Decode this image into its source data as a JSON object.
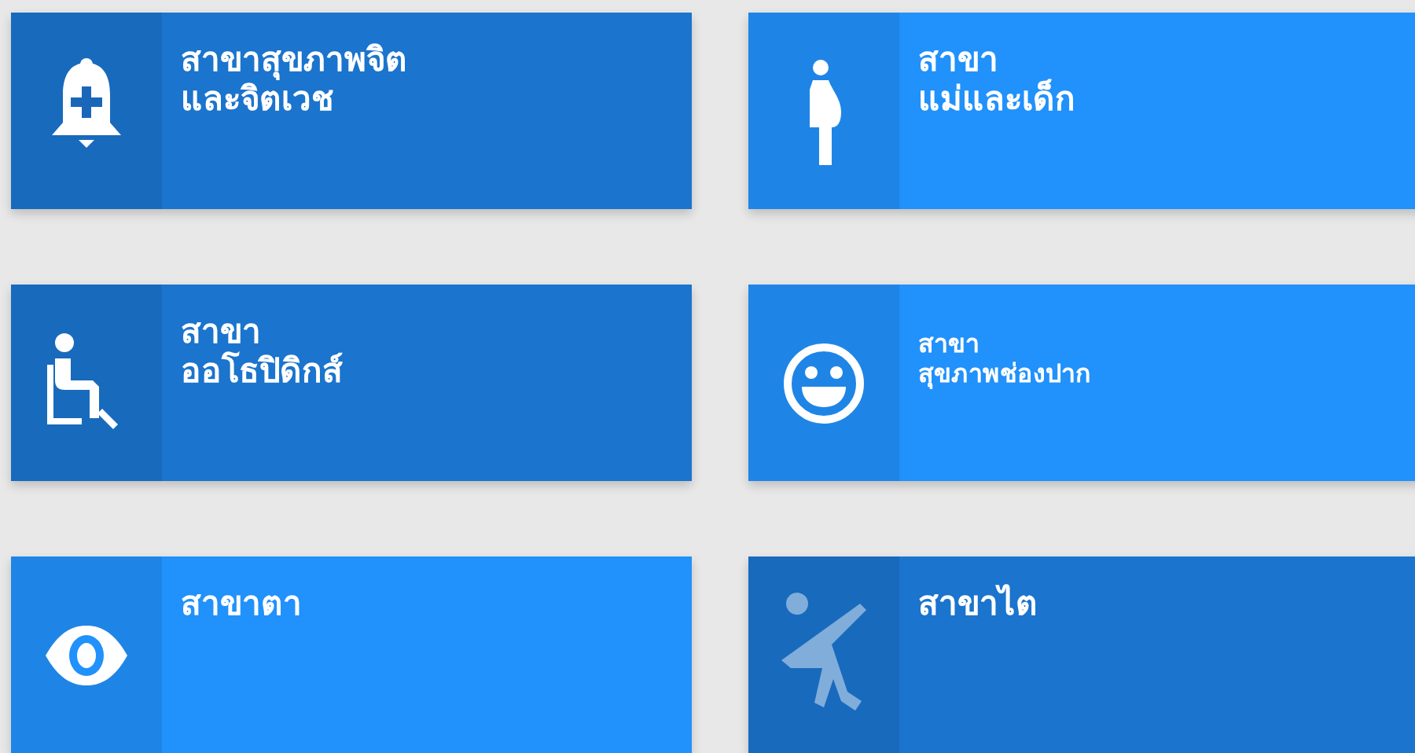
{
  "tiles": [
    {
      "lines": [
        "สาขาสุขภาพจิต",
        "และจิตเวช"
      ],
      "kind": "large",
      "color": "#1b74cd"
    },
    {
      "lines": [
        "สาขา",
        "แม่และเด็ก"
      ],
      "kind": "large",
      "color": "#2191fb"
    },
    {
      "lines": [
        "สาขา",
        "ออโธปิดิกส์"
      ],
      "kind": "large",
      "color": "#1b74cd"
    },
    {
      "lines": [
        "สาขา",
        "สุขภาพช่องปาก"
      ],
      "kind": "small",
      "color": "#2191fb"
    },
    {
      "lines": [
        "สาขาตา"
      ],
      "kind": "large",
      "color": "#2191fb"
    },
    {
      "lines": [
        "สาขาไต"
      ],
      "kind": "large",
      "color": "#1b74cd"
    }
  ]
}
